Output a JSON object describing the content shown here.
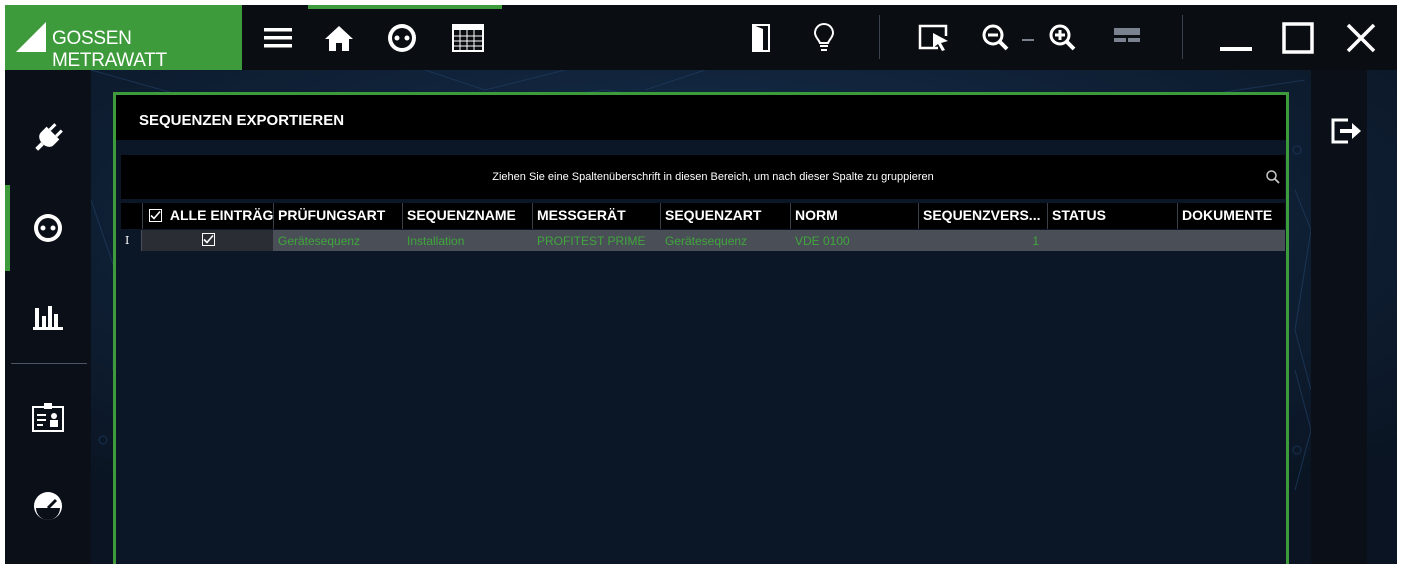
{
  "titlebar": {
    "brand": "GOSSEN METRAWATT",
    "icons": [
      "menu-icon",
      "home-icon",
      "socket-icon",
      "grid-icon",
      "door-icon",
      "lightbulb-icon",
      "select-cursor-icon",
      "zoom-out-icon",
      "zoom-in-icon",
      "panel-icon",
      "minimize-icon",
      "maximize-icon",
      "close-icon"
    ]
  },
  "sidebar": {
    "items": [
      {
        "icon": "plug-icon"
      },
      {
        "icon": "socket-icon",
        "active": true
      },
      {
        "icon": "bar-chart-icon"
      },
      {
        "icon": "id-card-icon"
      },
      {
        "icon": "gauge-icon"
      }
    ]
  },
  "rightpanel": {
    "icon": "logout-icon"
  },
  "dialog": {
    "title": "SEQUENZEN EXPORTIEREN",
    "group_hint": "Ziehen Sie eine Spaltenüberschrift in diesen Bereich, um nach dieser Spalte zu gruppieren",
    "columns": [
      "ALLE EINTRÄG",
      "PRÜFUNGSART",
      "SEQUENZNAME",
      "MESSGERÄT",
      "SEQUENZART",
      "NORM",
      "SEQUENZVERS...",
      "STATUS",
      "DOKUMENTE"
    ],
    "rows": [
      {
        "indicator": "I",
        "checked": true,
        "pruefungsart": "Gerätesequenz",
        "sequenzname": "Installation",
        "messgeraet": "PROFITEST PRIME",
        "sequenzart": "Gerätesequenz",
        "norm": "VDE 0100",
        "sequenzversion": "1",
        "status": "",
        "dokumente": ""
      }
    ]
  },
  "colors": {
    "accent": "#3e9b3c",
    "background": "#0c1726",
    "header": "#000000",
    "row_text": "#3fa63c"
  }
}
